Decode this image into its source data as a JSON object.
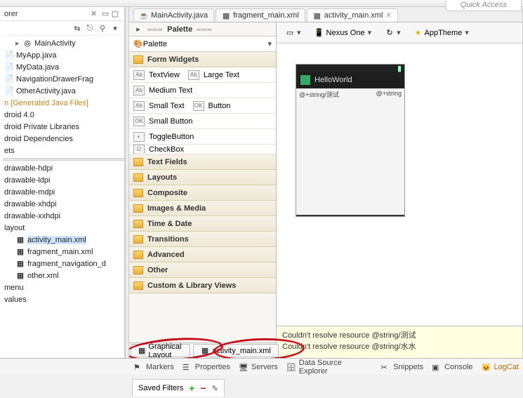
{
  "quick_access": "Quick Access",
  "sidebar": {
    "title": "orer",
    "items": [
      {
        "label": "MainActivity",
        "type": "class"
      },
      {
        "label": "MyApp.java",
        "type": "java"
      },
      {
        "label": "MyData.java",
        "type": "java"
      },
      {
        "label": "NavigationDrawerFrag",
        "type": "java"
      },
      {
        "label": "OtherActivity.java",
        "type": "java"
      }
    ],
    "gen_label": "n [Generated Java Files]",
    "android": [
      "droid 4.0",
      "droid Private Libraries",
      "droid Dependencies"
    ],
    "ets": "ets",
    "drawables": [
      "drawable-hdpi",
      "drawable-ldpi",
      "drawable-mdpi",
      "drawable-xhdpi",
      "drawable-xxhdpi"
    ],
    "layout_label": "layout",
    "layout_items": [
      "activity_main.xml",
      "fragment_main.xml",
      "fragment_navigation_d",
      "other.xml"
    ],
    "menu": "menu",
    "values": "values"
  },
  "editor_tabs": [
    {
      "label": "MainActivity.java",
      "icon": "java"
    },
    {
      "label": "fragment_main.xml",
      "icon": "xml"
    },
    {
      "label": "activity_main.xml",
      "icon": "xml",
      "active": true
    }
  ],
  "palette": {
    "header": "Palette",
    "dropdown": "Palette",
    "form_widgets": "Form Widgets",
    "items": [
      {
        "label": "TextView",
        "label2": "Large Text",
        "dual": true
      },
      {
        "label": "Medium Text"
      },
      {
        "label": "Small Text",
        "label2": "Button",
        "dual": true,
        "box2": "OK"
      },
      {
        "label": "Small Button",
        "box": "OK"
      },
      {
        "label": "ToggleButton",
        "toggle": true
      },
      {
        "label": "CheckBox",
        "check": true,
        "trunc": true
      }
    ],
    "cats": [
      "Text Fields",
      "Layouts",
      "Composite",
      "Images & Media",
      "Time & Date",
      "Transitions",
      "Advanced",
      "Other",
      "Custom & Library Views"
    ]
  },
  "sub_tabs": {
    "graphical": "Graphical Layout",
    "xml": "activity_main.xml"
  },
  "preview_toolbar": {
    "device": "Nexus One",
    "theme": "AppTheme"
  },
  "phone": {
    "app_title": "HelloWorld",
    "label1": "@+string/测试",
    "label2": "@+string"
  },
  "errors": [
    "Couldn't resolve resource @string/测试",
    "Couldn't resolve resource @string/水水"
  ],
  "bottom_views": [
    "Markers",
    "Properties",
    "Servers",
    "Data Source Explorer",
    "Snippets",
    "Console",
    "LogCat"
  ],
  "saved_filters": "Saved Filters"
}
